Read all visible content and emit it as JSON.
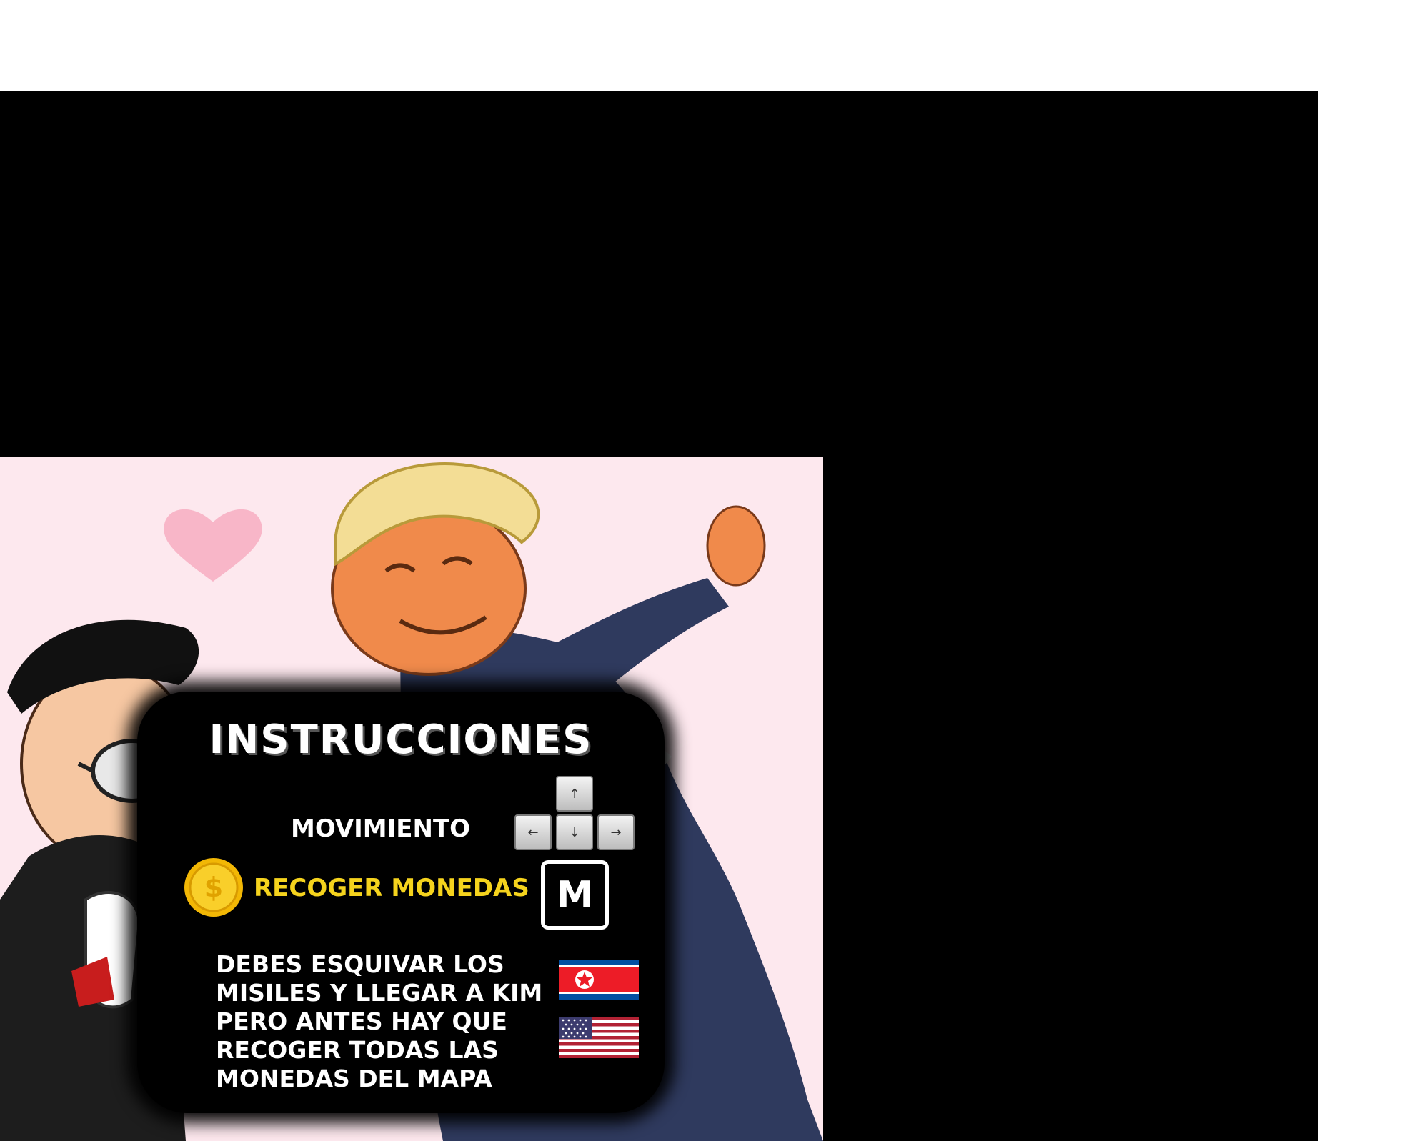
{
  "panel": {
    "title": "Instrucciones",
    "movement_label": "Movimiento",
    "coins_label": "Recoger monedas",
    "keys": {
      "up": "↑",
      "left": "←",
      "down": "↓",
      "right": "→",
      "collect": "M"
    },
    "description_lines": [
      "Debes esquivar los",
      "misiles y llegar a Kim",
      "pero antes hay que",
      "recoger todas las",
      "monedas del mapa"
    ]
  },
  "icons": {
    "coin": "dollar-coin-icon",
    "flag_1": "north-korea-flag-icon",
    "flag_2": "usa-flag-icon",
    "heart": "heart-icon"
  },
  "colors": {
    "background": "#000000",
    "scene": "#fde8ee",
    "text": "#ffffff",
    "coins_text": "#f5d31d",
    "heart": "#f8b6c8"
  }
}
